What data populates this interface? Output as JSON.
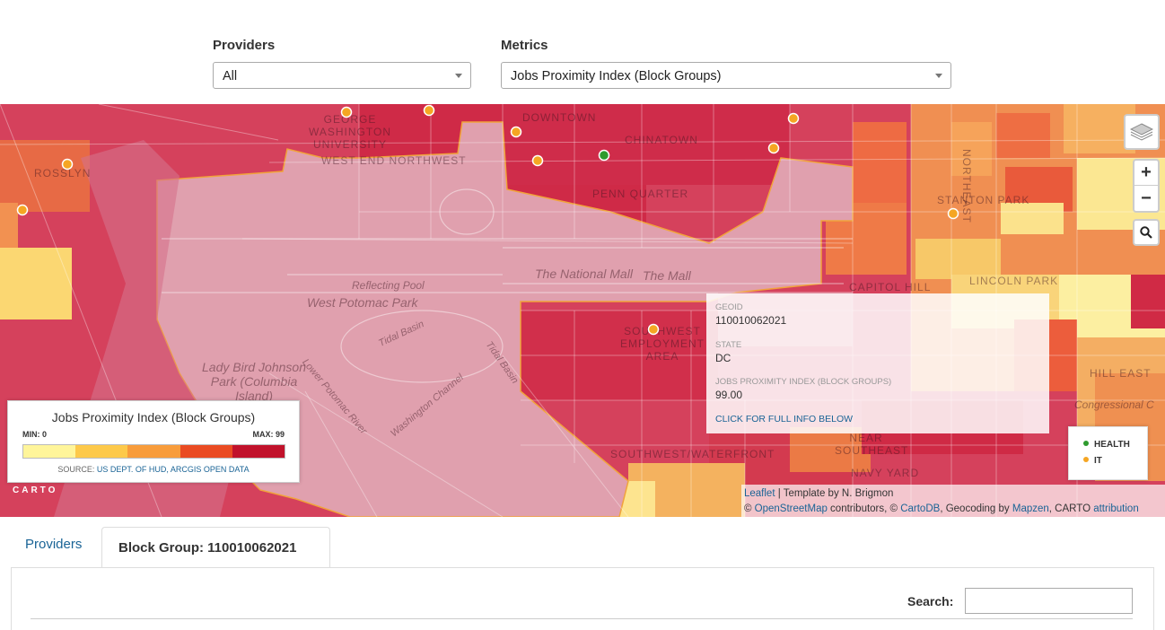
{
  "filters": {
    "providers_label": "Providers",
    "providers_value": "All",
    "metrics_label": "Metrics",
    "metrics_value": "Jobs Proximity Index (Block Groups)"
  },
  "map": {
    "labels": {
      "rosslyn": "ROSSLYN",
      "george_washington": "GEORGE WASHINGTON UNIVERSITY",
      "west_end": "WEST END NORTHWEST",
      "downtown": "DOWNTOWN",
      "chinatown": "CHINATOWN",
      "penn_quarter": "PENN QUARTER",
      "national_mall": "The National Mall",
      "the_mall": "The Mall",
      "reflecting_pool": "Reflecting Pool",
      "west_potomac_park": "West Potomac Park",
      "tidal_basin_1": "Tidal Basin",
      "tidal_basin_2": "Tidal Basin",
      "lady_bird": "Lady Bird Johnson Park (Columbia Island)",
      "lower_potomac": "Lower Potomac River",
      "washington_channel": "Washington Channel",
      "sw_employment": "SOUTHWEST EMPLOYMENT AREA",
      "southwest_waterfront": "SOUTHWEST/WATERFRONT",
      "near_southeast": "NEAR SOUTHEAST",
      "navy_yard": "NAVY YARD",
      "stanton_park": "STANTON PARK",
      "capitol_hill": "CAPITOL HILL",
      "lincoln_park": "LINCOLN PARK",
      "hill_east": "HILL EAST",
      "congressional": "Congressional C",
      "northeast": "NORTHEAST"
    },
    "zoom_in": "+",
    "zoom_out": "−",
    "layers_icon": "layers-icon",
    "search_icon": "search-icon",
    "carto_logo": "CARTO"
  },
  "legend": {
    "title": "Jobs Proximity Index (Block Groups)",
    "min_label": "MIN: 0",
    "max_label": "MAX: 99",
    "colors": [
      "#fff59a",
      "#fdc94a",
      "#f89c3b",
      "#ea4b22",
      "#c1122b"
    ],
    "source_prefix": "SOURCE: ",
    "source_link": "US DEPT. OF HUD, ARCGIS OPEN DATA"
  },
  "popup": {
    "geoid_label": "GEOID",
    "geoid_value": "110010062021",
    "state_label": "STATE",
    "state_value": "DC",
    "metric_label": "JOBS PROXIMITY INDEX (BLOCK GROUPS)",
    "metric_value": "99.00",
    "link": "CLICK FOR FULL INFO BELOW"
  },
  "point_legend": {
    "items": [
      {
        "label": "HEALTH",
        "color": "#2e9b2e"
      },
      {
        "label": "IT",
        "color": "#f5a623"
      }
    ]
  },
  "attribution": {
    "leaflet": "Leaflet",
    "template": " | Template by N. Brigmon",
    "copy": "© ",
    "osm": "OpenStreetMap",
    "contrib": " contributors, © ",
    "cartodb": "CartoDB",
    "geocoding": ", Geocoding by ",
    "mapzen": "Mapzen",
    "carto": ", CARTO ",
    "attribution_link": "attribution"
  },
  "tabs": {
    "providers": "Providers",
    "block_group": "Block Group: 110010062021"
  },
  "search": {
    "label": "Search:",
    "value": ""
  }
}
